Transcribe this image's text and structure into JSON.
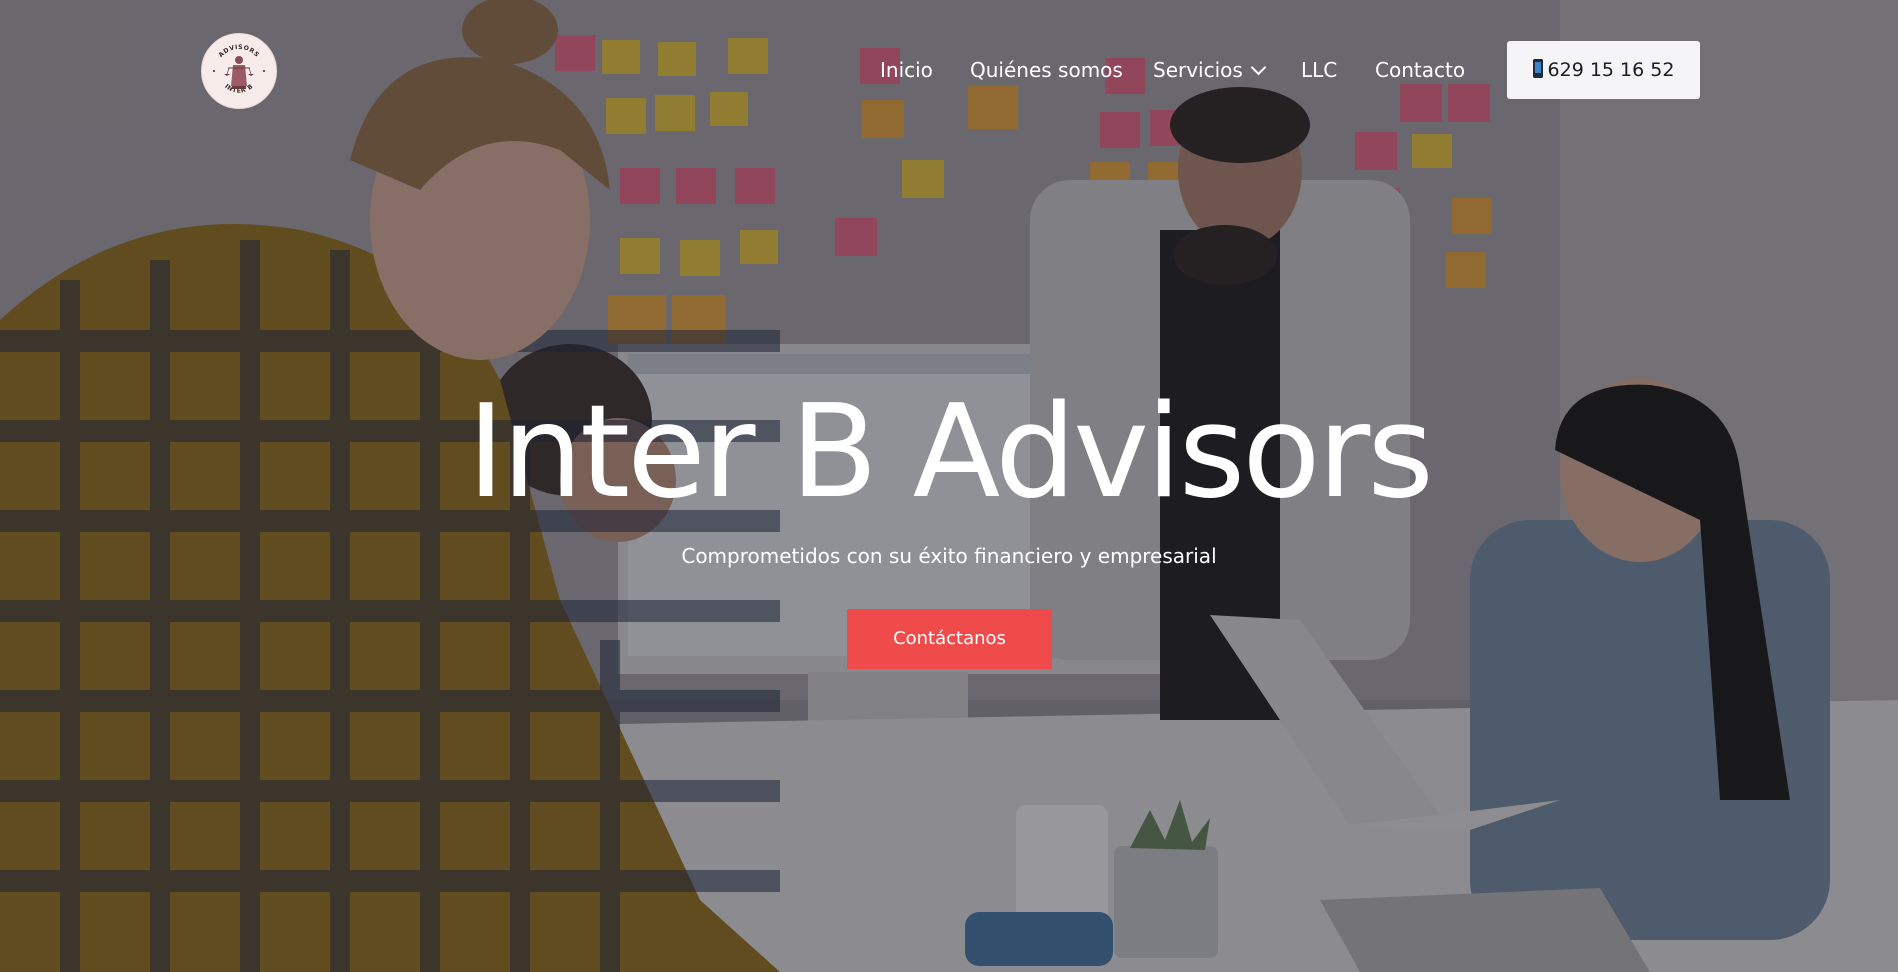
{
  "brand": {
    "name": "Inter B Advisors",
    "logo_top_text": "ADVISORS",
    "logo_bottom_text": "INTER B",
    "logo_icon": "justice-statue-icon"
  },
  "nav": {
    "items": [
      {
        "label": "Inicio"
      },
      {
        "label": "Quiénes somos"
      },
      {
        "label": "Servicios",
        "icon": "chevron-down-icon"
      },
      {
        "label": "LLC"
      },
      {
        "label": "Contacto"
      }
    ],
    "phone": {
      "label": "629 15 16 52",
      "icon": "mobile-phone-icon"
    }
  },
  "hero": {
    "title": "Inter B Advisors",
    "subtitle": "Comprometidos con su éxito financiero y empresarial",
    "cta_label": "Contáctanos",
    "background": "team-meeting-photo"
  },
  "colors": {
    "accent": "#ef4b4b",
    "phone_button_bg": "#f5f5f7",
    "text_light": "#ffffff",
    "logo_bg": "#f7ece9"
  }
}
